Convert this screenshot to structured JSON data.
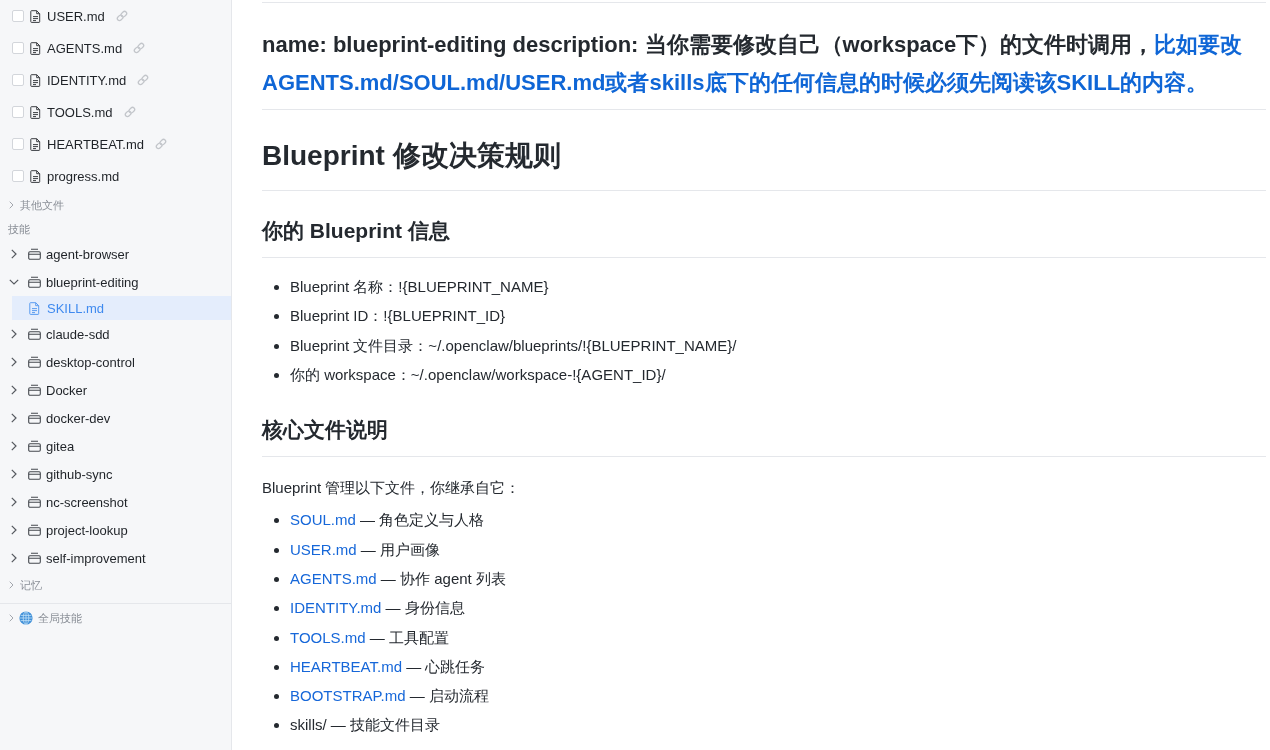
{
  "sidebar": {
    "files": [
      {
        "name": "USER.md",
        "checked": false,
        "linked": true,
        "selected": false
      },
      {
        "name": "AGENTS.md",
        "checked": false,
        "linked": true,
        "selected": false
      },
      {
        "name": "IDENTITY.md",
        "checked": false,
        "linked": true,
        "selected": false
      },
      {
        "name": "TOOLS.md",
        "checked": false,
        "linked": true,
        "selected": false
      },
      {
        "name": "HEARTBEAT.md",
        "checked": false,
        "linked": true,
        "selected": false
      },
      {
        "name": "progress.md",
        "checked": false,
        "linked": false,
        "selected": false
      }
    ],
    "other_files": {
      "label": "其他文件",
      "expanded": false
    },
    "skills": {
      "label": "技能",
      "items": [
        {
          "name": "agent-browser",
          "expanded": false,
          "selected": false
        },
        {
          "name": "blueprint-editing",
          "expanded": true,
          "selected": false,
          "children": [
            {
              "name": "SKILL.md",
              "selected": true
            }
          ]
        },
        {
          "name": "claude-sdd",
          "expanded": false,
          "selected": false
        },
        {
          "name": "desktop-control",
          "expanded": false,
          "selected": false
        },
        {
          "name": "Docker",
          "expanded": false,
          "selected": false
        },
        {
          "name": "docker-dev",
          "expanded": false,
          "selected": false
        },
        {
          "name": "gitea",
          "expanded": false,
          "selected": false
        },
        {
          "name": "github-sync",
          "expanded": false,
          "selected": false
        },
        {
          "name": "nc-screenshot",
          "expanded": false,
          "selected": false
        },
        {
          "name": "project-lookup",
          "expanded": false,
          "selected": false
        },
        {
          "name": "self-improvement",
          "expanded": false,
          "selected": false
        }
      ]
    },
    "memory": {
      "label": "记忆",
      "expanded": false
    },
    "global_skills": {
      "label": "全局技能",
      "expanded": false
    }
  },
  "document": {
    "blocks": [
      {
        "kind": "frontmatter",
        "parts": [
          {
            "kind": "plain",
            "text": "name: blueprint-editing description: 当你需要修改自己（workspace下）的文件时调用，"
          },
          {
            "kind": "accent",
            "text": "比如要改AGENTS.md/SOUL.md/USER.md或者skills底下的任何信息的时候必须先阅读该SKILL的内容。"
          }
        ]
      },
      {
        "kind": "h1",
        "text": "Blueprint 修改决策规则"
      },
      {
        "kind": "h2",
        "text": "你的 Blueprint 信息"
      },
      {
        "kind": "list",
        "items": [
          {
            "text": "Blueprint 名称：!{BLUEPRINT_NAME}"
          },
          {
            "text": "Blueprint ID：!{BLUEPRINT_ID}"
          },
          {
            "text": "Blueprint 文件目录：~/.openclaw/blueprints/!{BLUEPRINT_NAME}/"
          },
          {
            "text": "你的 workspace：~/.openclaw/workspace-!{AGENT_ID}/"
          }
        ]
      },
      {
        "kind": "h2",
        "text": "核心文件说明"
      },
      {
        "kind": "paragraph",
        "text": "Blueprint 管理以下文件，你继承自它："
      },
      {
        "kind": "list",
        "items": [
          {
            "link": "SOUL.md",
            "text": "— 角色定义与人格"
          },
          {
            "link": "USER.md",
            "text": "— 用户画像"
          },
          {
            "link": "AGENTS.md",
            "text": "— 协作 agent 列表"
          },
          {
            "link": "IDENTITY.md",
            "text": "— 身份信息"
          },
          {
            "link": "TOOLS.md",
            "text": "— 工具配置"
          },
          {
            "link": "HEARTBEAT.md",
            "text": "— 心跳任务"
          },
          {
            "link": "BOOTSTRAP.md",
            "text": "— 启动流程"
          },
          {
            "text": "skills/ — 技能文件目录"
          }
        ]
      }
    ]
  }
}
